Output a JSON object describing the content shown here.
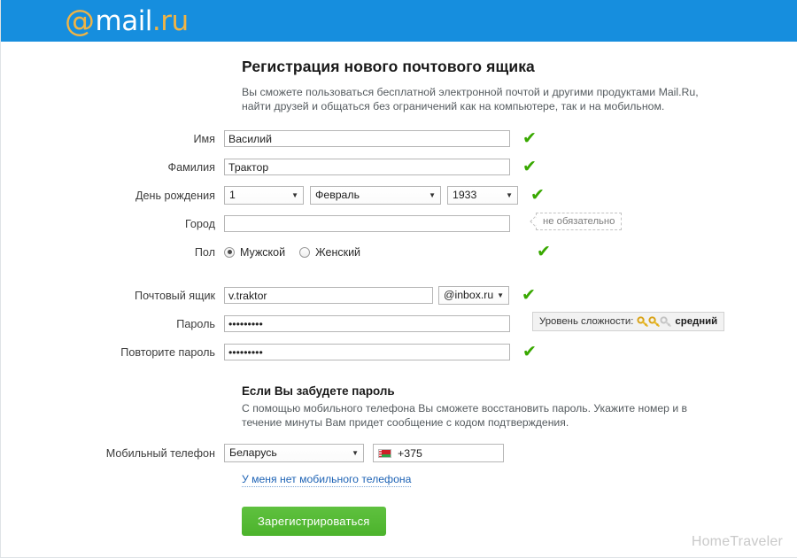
{
  "brand": {
    "logo_at": "@",
    "logo_mail": "mail",
    "logo_dot": ".",
    "logo_ru": "ru",
    "header_color": "#168ede",
    "accent_green": "#38a800",
    "link_blue": "#1e63b5",
    "button_green": "#4cb32c"
  },
  "page": {
    "title": "Регистрация нового почтового ящика",
    "subtitle": "Вы сможете пользоваться бесплатной электронной почтой и другими продуктами Mail.Ru, найти друзей и общаться без ограничений как на компьютере, так и на мобильном."
  },
  "form": {
    "first_name": {
      "label": "Имя",
      "value": "Василий",
      "valid_icon": "✔"
    },
    "last_name": {
      "label": "Фамилия",
      "value": "Трактор",
      "valid_icon": "✔"
    },
    "birthday": {
      "label": "День рождения",
      "day": "1",
      "month": "Февраль",
      "year": "1933",
      "arrow_icon": "▼",
      "valid_icon": "✔"
    },
    "city": {
      "label": "Город",
      "value": "",
      "placeholder": "",
      "hint": "не обязательно"
    },
    "gender": {
      "label": "Пол",
      "options": [
        {
          "label": "Мужской",
          "selected": true
        },
        {
          "label": "Женский",
          "selected": false
        }
      ],
      "valid_icon": "✔"
    },
    "mailbox": {
      "label": "Почтовый ящик",
      "value": "v.traktor",
      "domain": "@inbox.ru",
      "arrow_icon": "▼",
      "valid_icon": "✔"
    },
    "password": {
      "label": "Пароль",
      "value": "•••••••••",
      "strength_label": "Уровень сложности:",
      "strength_level": "средний",
      "keys_filled": 2,
      "keys_total": 3
    },
    "password_repeat": {
      "label": "Повторите пароль",
      "value": "•••••••••",
      "valid_icon": "✔"
    }
  },
  "recovery": {
    "title": "Если Вы забудете пароль",
    "text": "С помощью мобильного телефона Вы сможете восстановить пароль. Укажите номер и в течение минуты Вам придет сообщение с кодом подтверждения.",
    "phone": {
      "label": "Мобильный телефон",
      "country": "Беларусь",
      "arrow_icon": "▼",
      "code": "+375",
      "flag_name": "belarus-flag"
    },
    "no_phone_link": "У меня нет мобильного телефона"
  },
  "actions": {
    "submit_label": "Зарегистрироваться"
  },
  "watermark": "HomeTraveler"
}
